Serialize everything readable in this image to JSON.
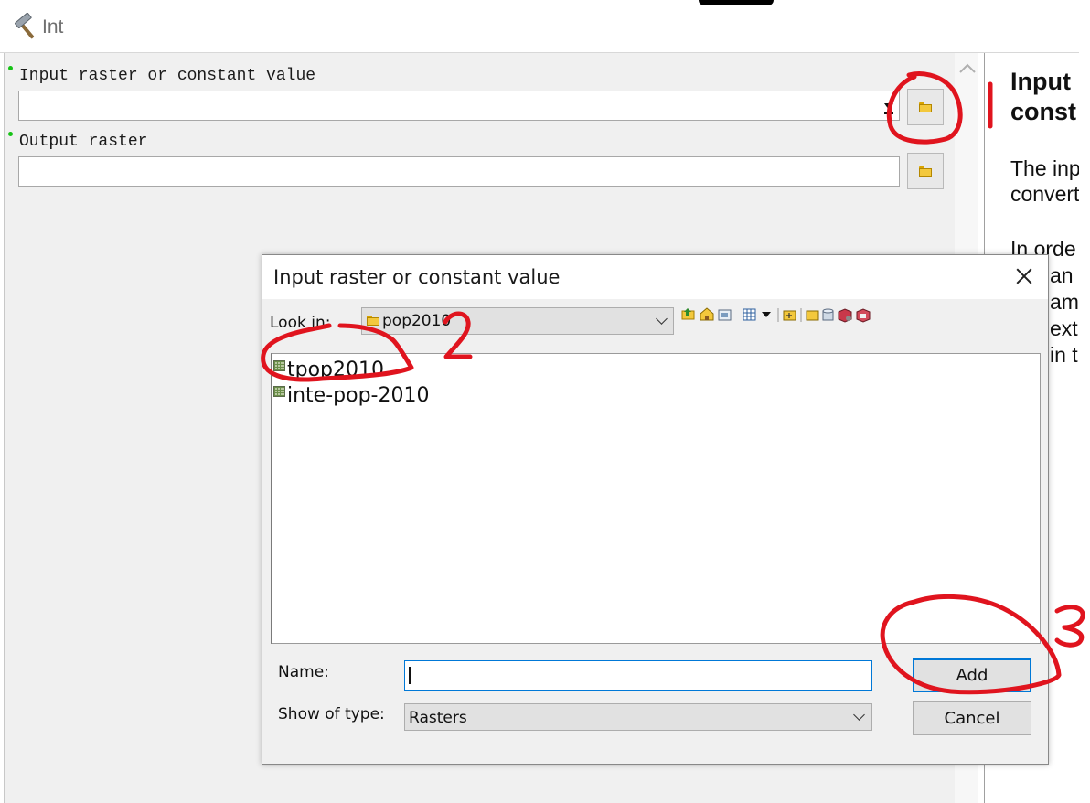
{
  "tool": {
    "title": "Int",
    "icon": "hammer-icon"
  },
  "parameters": [
    {
      "label": "Input raster or constant value",
      "value": ""
    },
    {
      "label": "Output raster",
      "value": ""
    }
  ],
  "help": {
    "title_lines": [
      "Input",
      "const"
    ],
    "para1_lines": [
      "The inp",
      "convert"
    ],
    "para2_lines": [
      "In orde",
      "an i",
      "ame",
      "ext",
      "in t"
    ]
  },
  "dialog": {
    "title": "Input raster or constant value",
    "look_in_label": "Look in:",
    "look_in_value": "pop2010",
    "items": [
      {
        "name": "tpop2010",
        "icon": "raster-dataset-icon"
      },
      {
        "name": "inte-pop-2010",
        "icon": "raster-dataset-icon"
      }
    ],
    "name_label": "Name:",
    "name_value": "",
    "type_label": "Show of type:",
    "type_value": "Rasters",
    "add_label": "Add",
    "cancel_label": "Cancel"
  },
  "annotations": [
    "1",
    "2",
    "3"
  ],
  "colors": {
    "annotation": "#e0141e",
    "accent": "#0078d7",
    "required_dot": "#16c316"
  }
}
